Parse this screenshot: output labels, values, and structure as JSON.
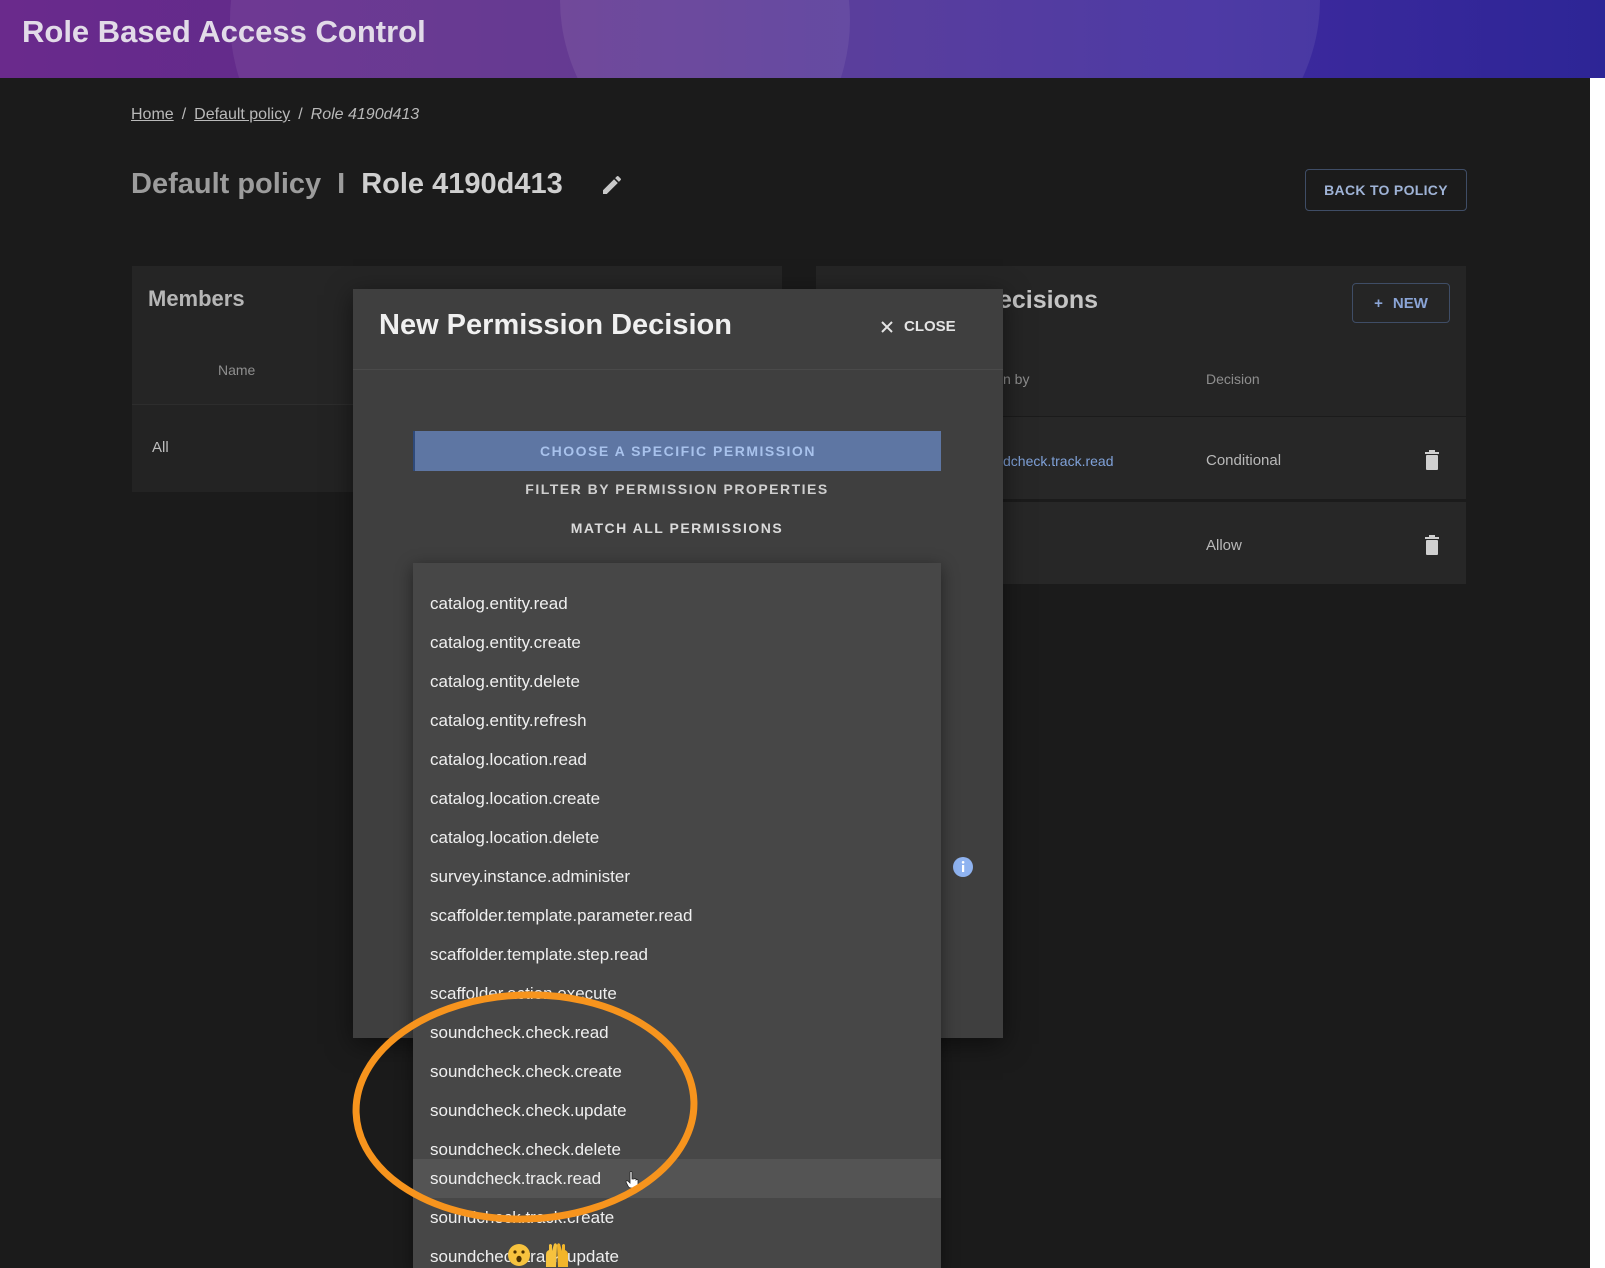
{
  "header": {
    "title": "Role Based Access Control"
  },
  "breadcrumb": {
    "home": "Home",
    "policy": "Default policy",
    "sep": "/",
    "current": "Role 4190d413"
  },
  "page": {
    "policy_name": "Default policy",
    "divider": "I",
    "role_name": "Role 4190d413",
    "back_button": "BACK TO POLICY"
  },
  "members": {
    "title": "Members",
    "column_name": "Name",
    "rows": [
      "All"
    ]
  },
  "decisions": {
    "title_visible": "ecisions",
    "new_button": "NEW",
    "column_by": "n by",
    "column_decision": "Decision",
    "rows": [
      {
        "permission": "dcheck.track.read",
        "decision": "Conditional"
      },
      {
        "permission": "",
        "decision": "Allow"
      }
    ]
  },
  "modal": {
    "title": "New Permission Decision",
    "close_label": "CLOSE",
    "options": {
      "choose": "CHOOSE A SPECIFIC PERMISSION",
      "filter": "FILTER BY PERMISSION PROPERTIES",
      "match": "MATCH ALL PERMISSIONS"
    },
    "permissions": [
      "catalog.entity.read",
      "catalog.entity.create",
      "catalog.entity.delete",
      "catalog.entity.refresh",
      "catalog.location.read",
      "catalog.location.create",
      "catalog.location.delete",
      "survey.instance.administer",
      "scaffolder.template.parameter.read",
      "scaffolder.template.step.read",
      "scaffolder.action.execute",
      "soundcheck.check.read",
      "soundcheck.check.create",
      "soundcheck.check.update",
      "soundcheck.check.delete",
      "soundcheck.track.read",
      "soundcheck.track.create",
      "soundcheck.track.update"
    ],
    "hovered_item": "soundcheck.track.read"
  },
  "colors": {
    "header_start": "#6a2a8c",
    "header_end": "#2d2596",
    "accent_button": "#5e76a3",
    "highlight_ring": "#f7941d"
  }
}
